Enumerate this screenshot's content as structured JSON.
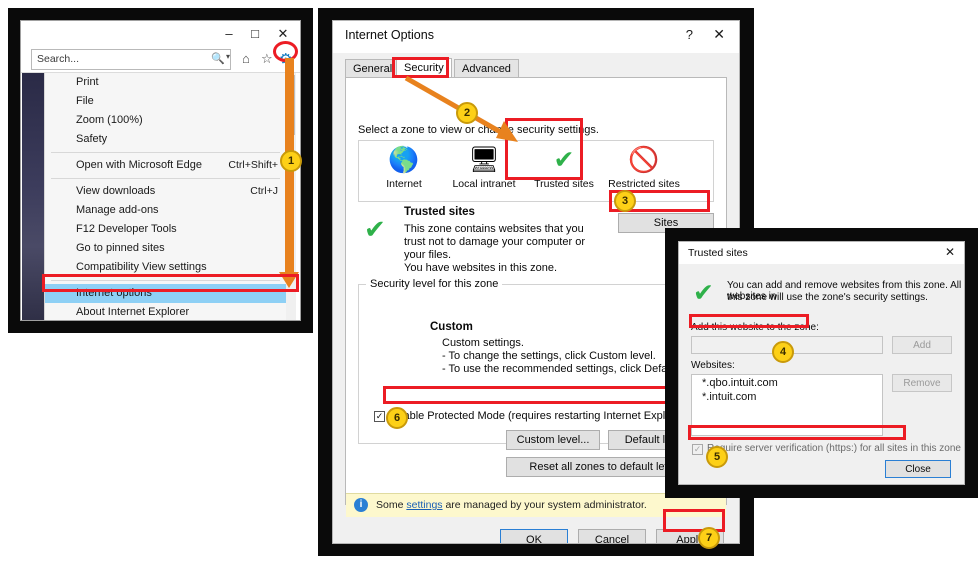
{
  "panel1": {
    "name": "Internet Explorer window with gear menu open",
    "titlebar": {
      "minimize": "–",
      "maximize": "□",
      "close": "✕"
    },
    "search": {
      "placeholder": "Search...",
      "value": "",
      "search_icon": "🔍",
      "dropdown_caret": "▾"
    },
    "toolbar_icons": {
      "home": "⌂",
      "favorites": "☆",
      "tools_gear": "⚙"
    },
    "menu_items": [
      {
        "label": "Print",
        "shortcut": "",
        "selected": false,
        "separator_after": false
      },
      {
        "label": "File",
        "shortcut": "",
        "selected": false,
        "separator_after": false
      },
      {
        "label": "Zoom (100%)",
        "shortcut": "",
        "selected": false,
        "separator_after": false
      },
      {
        "label": "Safety",
        "shortcut": "",
        "selected": false,
        "separator_after": true
      },
      {
        "label": "Open with Microsoft Edge",
        "shortcut": "Ctrl+Shift+",
        "selected": false,
        "separator_after": true
      },
      {
        "label": "View downloads",
        "shortcut": "Ctrl+J",
        "selected": false,
        "separator_after": false
      },
      {
        "label": "Manage add-ons",
        "shortcut": "",
        "selected": false,
        "separator_after": false
      },
      {
        "label": "F12 Developer Tools",
        "shortcut": "",
        "selected": false,
        "separator_after": false
      },
      {
        "label": "Go to pinned sites",
        "shortcut": "",
        "selected": false,
        "separator_after": false
      },
      {
        "label": "Compatibility View settings",
        "shortcut": "",
        "selected": false,
        "separator_after": true
      },
      {
        "label": "Internet options",
        "shortcut": "",
        "selected": true,
        "separator_after": false
      },
      {
        "label": "About Internet Explorer",
        "shortcut": "",
        "selected": false,
        "separator_after": false
      }
    ]
  },
  "panel2": {
    "title": "Internet Options",
    "help_glyph": "?",
    "close_glyph": "✕",
    "tabs": [
      {
        "label": "General",
        "active": false
      },
      {
        "label": "Security",
        "active": true
      },
      {
        "label": "Advanced",
        "active": false
      }
    ],
    "zone_prompt": "Select a zone to view or change security settings.",
    "zones": [
      {
        "label": "Internet",
        "icon": "globe-icon",
        "glyph": "🌎",
        "selected": false
      },
      {
        "label": "Local intranet",
        "icon": "intranet-icon",
        "glyph": "🖥",
        "selected": false
      },
      {
        "label": "Trusted sites",
        "icon": "check-icon",
        "glyph": "✔",
        "selected": true
      },
      {
        "label": "Restricted sites",
        "icon": "restricted-icon",
        "glyph": "🚫",
        "selected": false
      }
    ],
    "selected_zone": {
      "name": "Trusted sites",
      "description_line1": "This zone contains websites that you",
      "description_line2": "trust not to damage your computer or",
      "description_line3": "your files.",
      "description_line4": "You have websites in this zone.",
      "sites_button": "Sites"
    },
    "security_level": {
      "legend": "Security level for this zone",
      "level_name": "Custom",
      "line1": "Custom settings.",
      "line2": "- To change the settings, click Custom level.",
      "line3": "- To use the recommended settings, click Default level.",
      "protected_mode_label": "Enable Protected Mode (requires restarting Internet Explorer)",
      "protected_mode_checked": true,
      "custom_level_button": "Custom level...",
      "default_level_button": "Default level",
      "reset_button": "Reset all zones to default level"
    },
    "info_bar": {
      "icon": "info-icon",
      "text_before": "Some ",
      "link": "settings",
      "text_after": " are managed by your system administrator."
    },
    "footer_buttons": [
      {
        "label": "OK",
        "default": true
      },
      {
        "label": "Cancel",
        "default": false
      },
      {
        "label": "Apply",
        "default": false
      }
    ]
  },
  "panel3": {
    "title": "Trusted sites",
    "close_glyph": "✕",
    "check_icon": "✔",
    "intro_line1": "You can add and remove websites from this zone. All websites in",
    "intro_line2": "this zone will use the zone's security settings.",
    "add_label": "Add this website to the zone:",
    "add_input_value": "",
    "add_button": "Add",
    "websites_label": "Websites:",
    "websites": [
      "*.qbo.intuit.com",
      "*.intuit.com"
    ],
    "remove_button": "Remove",
    "require_https_label": "Require server verification (https:) for all sites in this zone",
    "require_https_checked": false,
    "require_https_disabled": true,
    "close_button": "Close"
  },
  "step_badges": [
    {
      "number": "1",
      "target": "internet-options-menu-item"
    },
    {
      "number": "2",
      "target": "security-tab-to-trusted-sites"
    },
    {
      "number": "3",
      "target": "sites-button"
    },
    {
      "number": "4",
      "target": "add-website-field"
    },
    {
      "number": "5",
      "target": "require-https-checkbox"
    },
    {
      "number": "6",
      "target": "enable-protected-mode-checkbox"
    },
    {
      "number": "7",
      "target": "apply-button"
    }
  ],
  "colors": {
    "highlight_red": "#ec1c24",
    "badge_yellow": "#fdd017",
    "arrow_orange": "#e8821e",
    "selection_blue": "#8ed0f5",
    "check_green": "#2fb14a",
    "info_yellow": "#fdf8cd"
  }
}
